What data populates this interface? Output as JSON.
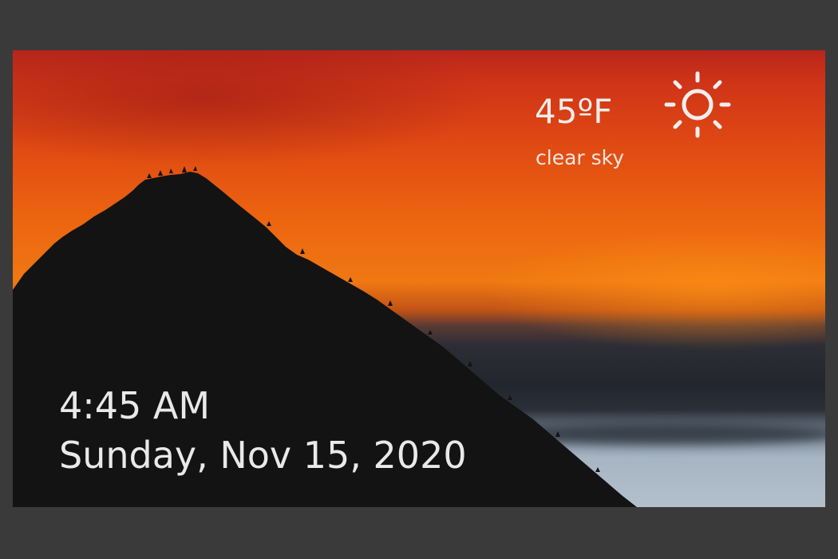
{
  "weather": {
    "temperature": "45ºF",
    "description": "clear sky",
    "icon": "sun-icon"
  },
  "clock": {
    "time": "4:45 AM",
    "date": "Sunday, Nov 15, 2020"
  },
  "background": {
    "scene": "mountain-sunset",
    "colors": {
      "sky_top": "#b8261a",
      "sky_mid": "#ec6410",
      "sky_glow": "#f07812",
      "cloud_dark": "#23262e",
      "sky_low": "#b3c0cc",
      "mountain": "#131313"
    }
  },
  "frame_background": "#3a3a3a",
  "text_color": "#e9e9e9"
}
